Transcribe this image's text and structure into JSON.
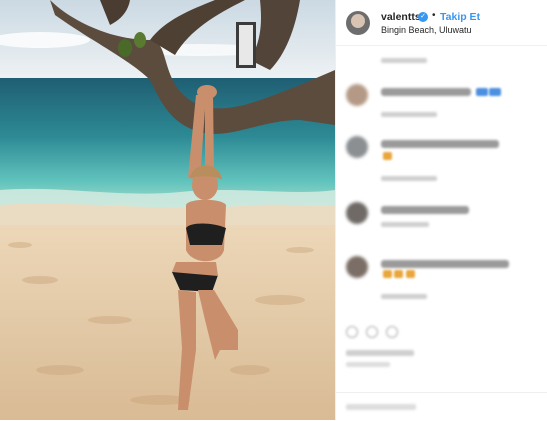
{
  "post": {
    "username": "valentts",
    "verified_badge": "✓",
    "separator": "•",
    "follow_label": "Takip Et",
    "location": "Bingin Beach, Uluwatu"
  },
  "photo": {
    "subject": "beach-photo",
    "colors": {
      "sky": "#dfe8ef",
      "sea_far": "#2b6e82",
      "sea_near": "#5cc2bf",
      "sand": "#e8d0ae",
      "branch": "#5a4a3c"
    }
  },
  "comments": [
    {
      "avatar_color": "#b49a86",
      "text_width": 90,
      "meta_width": 56,
      "has_blue": true
    },
    {
      "avatar_color": "#8b8f92",
      "text_width": 118,
      "meta_width": 56,
      "has_orange": true
    },
    {
      "avatar_color": "#6f6a66",
      "text_width": 88,
      "meta_width": 48
    },
    {
      "avatar_color": "#7b6e66",
      "text_width": 128,
      "meta_width": 56,
      "has_orange": true
    }
  ]
}
